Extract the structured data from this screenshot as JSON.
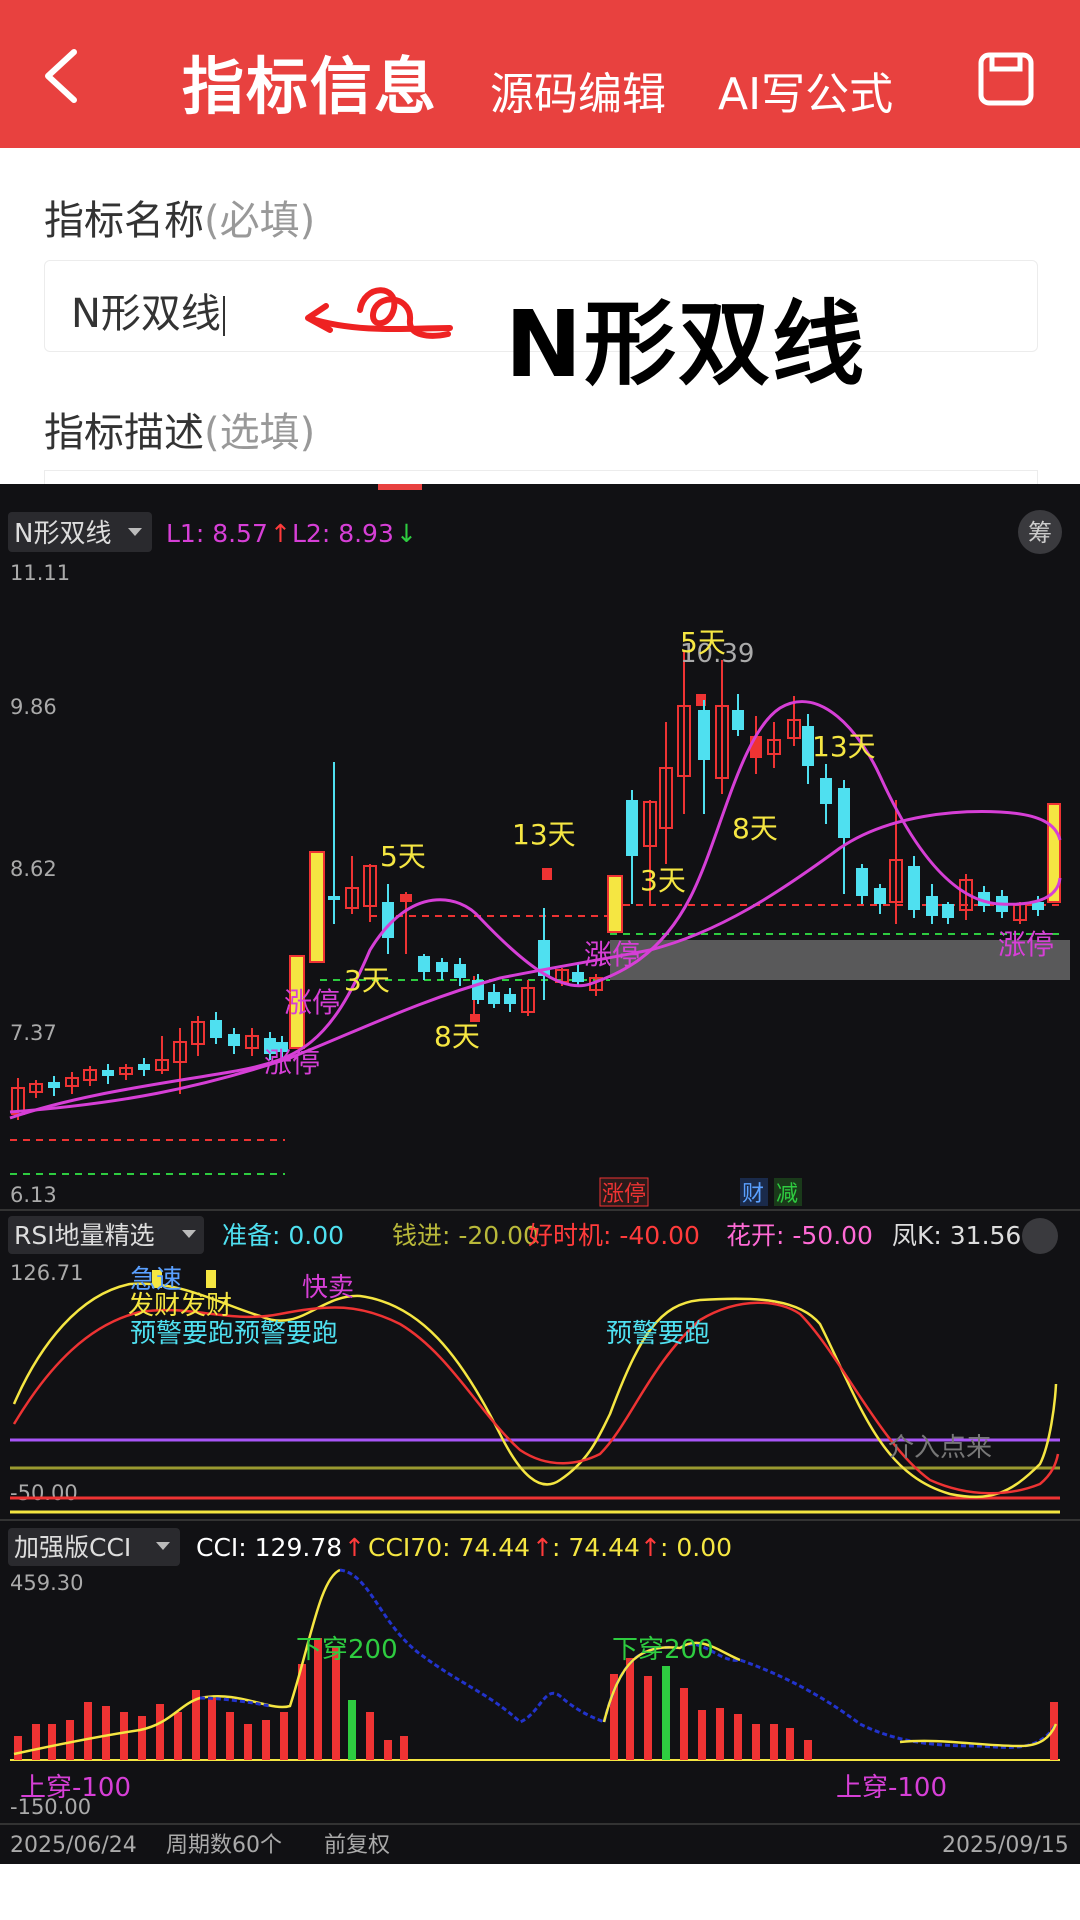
{
  "header": {
    "title": "指标信息",
    "tab_source": "源码编辑",
    "tab_ai": "AI写公式"
  },
  "form": {
    "name_label": "指标名称",
    "name_hint": "(必填)",
    "name_value": "N形双线",
    "desc_label": "指标描述",
    "desc_hint": "(选填)"
  },
  "overlay_title": "N形双线",
  "colors": {
    "accent": "#e8413f",
    "magenta": "#d63fd6",
    "yellow": "#f5e642",
    "cyan": "#4fe0f0"
  },
  "main_chart": {
    "indicator_selector": "N形双线",
    "l1": "L1: 8.57",
    "l2": "L2: 8.93",
    "badge": "筹",
    "y_labels": [
      "11.11",
      "9.86",
      "8.62",
      "7.37",
      "6.13"
    ],
    "peak_label": "10.39",
    "day_tags": [
      "5天",
      "3天",
      "8天",
      "13天",
      "5天",
      "3天",
      "8天",
      "13天"
    ],
    "limit_up": [
      "涨停",
      "涨停",
      "涨停",
      "涨停"
    ],
    "bottom_tags": [
      "涨停",
      "财",
      "减"
    ]
  },
  "rsi_panel": {
    "selector": "RSI地量精选",
    "ready": "准备: 0.00",
    "money": "钱进: -20.00",
    "timing": "好时机: -40.00",
    "bloom": "花开: -50.00",
    "phoenix": "凤K: 31.56",
    "y_top": "126.71",
    "y_bot": "-50.00",
    "signals": [
      "急速",
      "发财发财",
      "预警要跑预警要跑",
      "快卖",
      "预警要跑",
      "介入点来"
    ]
  },
  "cci_panel": {
    "selector": "加强版CCI",
    "cci": "CCI: 129.78",
    "cci70": "CCI70: 74.44",
    "v3": ": 74.44",
    "v4": ": 0.00",
    "y_top": "459.30",
    "y_bot": "-150.00",
    "tags": [
      "下穿200",
      "下穿200",
      "上穿-100",
      "上穿-100"
    ]
  },
  "footer": {
    "start": "2025/06/24",
    "period": "周期数60个",
    "adj": "前复权",
    "end": "2025/09/15"
  }
}
